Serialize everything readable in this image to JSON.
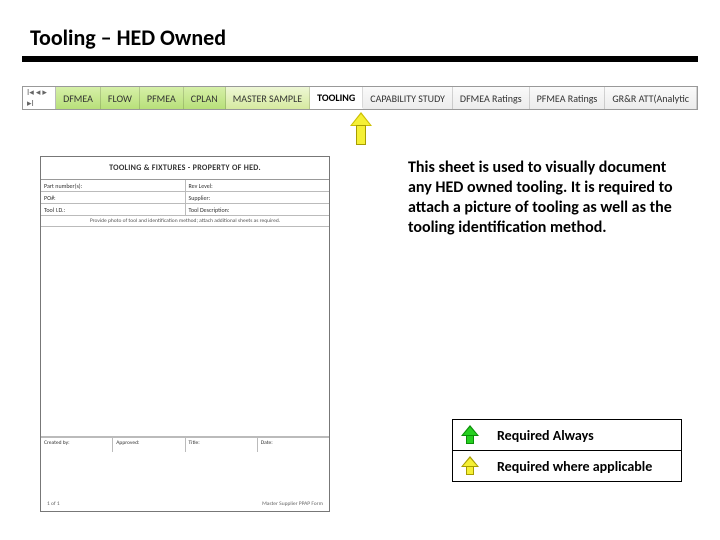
{
  "title": "Tooling – HED Owned",
  "tabs": {
    "nav_glyphs": "I◂ ◂ ▸ ▸I",
    "items": [
      {
        "label": "DFMEA",
        "cls": "g1"
      },
      {
        "label": "FLOW",
        "cls": "g1"
      },
      {
        "label": "PFMEA",
        "cls": "g1"
      },
      {
        "label": "CPLAN",
        "cls": "g1"
      },
      {
        "label": "MASTER SAMPLE",
        "cls": "g2"
      },
      {
        "label": "TOOLING",
        "cls": "active"
      },
      {
        "label": "CAPABILITY STUDY",
        "cls": "cap"
      },
      {
        "label": "DFMEA Ratings",
        "cls": "cap"
      },
      {
        "label": "PFMEA Ratings",
        "cls": "cap"
      },
      {
        "label": "GR&R ATT(Analytic",
        "cls": "cap"
      }
    ]
  },
  "doc": {
    "title": "TOOLING & FIXTURES - PROPERTY OF HED.",
    "meta": {
      "r1a": "Part number(s):",
      "r1b": "Rev Level:",
      "r2a": "PO#:",
      "r2b": "Supplier:",
      "r3a": "Tool I.D.:",
      "r3b": "Tool Description:"
    },
    "note": "Provide photo of tool and identification method; attach additional sheets as required.",
    "sign": {
      "a": "Created by:",
      "b": "Approved:",
      "c": "Title:",
      "d": "Date:"
    },
    "footer_left": "1 of 1",
    "footer_right": "Master Supplier PPAP Form"
  },
  "description": "This sheet is used to visually document any HED owned tooling. It is required to attach a picture of tooling as well as the tooling identification method.",
  "legend": {
    "always": "Required Always",
    "applicable": "Required where applicable"
  }
}
